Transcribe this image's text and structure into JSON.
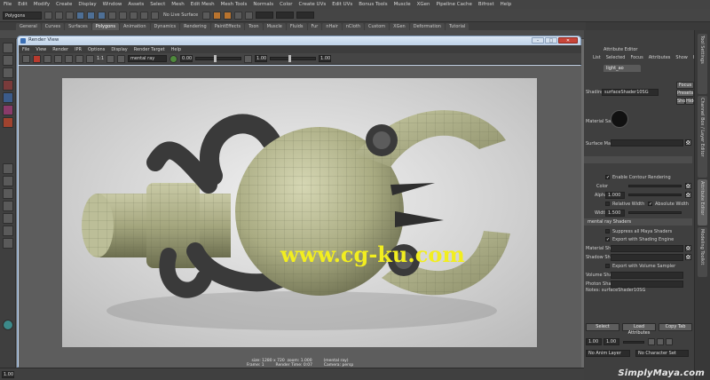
{
  "main_menu": [
    "File",
    "Edit",
    "Modify",
    "Create",
    "Display",
    "Window",
    "Assets",
    "Select",
    "Mesh",
    "Edit Mesh",
    "Mesh Tools",
    "Normals",
    "Color",
    "Create UVs",
    "Edit UVs",
    "Bonus Tools",
    "Muscle",
    "XGen",
    "Pipeline Cache",
    "Bifrost",
    "Help"
  ],
  "status_line": {
    "mode": "Polygons",
    "live_surface": "No Live Surface"
  },
  "shelf_tabs": [
    "General",
    "Curves",
    "Surfaces",
    "Polygons",
    "Animation",
    "Dynamics",
    "Rendering",
    "PaintEffects",
    "Toon",
    "Muscle",
    "Fluids",
    "Fur",
    "nHair",
    "nCloth",
    "Custom",
    "XGen",
    "Deformation",
    "Tutorial"
  ],
  "shelf_active": "Polygons",
  "render_view": {
    "title": "Render View",
    "menu": [
      "File",
      "View",
      "Render",
      "IPR",
      "Options",
      "Display",
      "Render Target",
      "Help"
    ],
    "renderer": "mental ray",
    "ratio_label": "1:1",
    "exposure": "0.00",
    "gamma": "1.00",
    "gamma2": "1.00",
    "info_line1": "size: 1280 x 720  zoom: 1.000         (mental ray)",
    "info_line2": "Frame: 1         Render Time: 0:07         Camera: persp",
    "window_buttons": {
      "minimize": "–",
      "maximize": "□",
      "close": "✕"
    }
  },
  "watermark_text": "www.cg-ku.com",
  "attribute_editor": {
    "title": "Attribute Editor",
    "menu": [
      "List",
      "Selected",
      "Focus",
      "Attributes",
      "Show",
      "Help"
    ],
    "node_tab": "light_ao",
    "shading_engine_label": "ShadingEngine:",
    "shading_engine_value": "surfaceShader10SG",
    "focus_btn": "Focus",
    "presets_btn": "Presets",
    "show_btn": "Show",
    "hide_btn": "Hide",
    "swatch_label": "Material Sample",
    "material_label": "Surface Material",
    "contour_label": "Enable Contour Rendering",
    "color_label": "Color",
    "alpha_label": "Alpha",
    "alpha_value": "1.000",
    "relative_width_label": "Relative Width",
    "absolute_width_label": "Absolute Width",
    "width_label": "Width",
    "width_value": "1.500",
    "shaders_section": "mental ray Shaders",
    "suppress_label": "Suppress all Maya Shaders",
    "export_engine_label": "Export with Shading Engine",
    "material_shader_label": "Material Shader",
    "shadow_shader_label": "Shadow Shader",
    "export_volume_label": "Export with Volume Sampler",
    "volume_shader_label": "Volume Shader",
    "photon_shader_label": "Photon Shader",
    "notes_label": "Notes: surfaceShader10SG",
    "bottom_buttons": [
      "Select",
      "Load Attributes",
      "Copy Tab"
    ]
  },
  "right_tabs": [
    "Tool Settings",
    "Channel Box / Layer Editor",
    "Attribute Editor",
    "Modeling Toolkit"
  ],
  "range_bar": {
    "start": "1.00",
    "end": "1.00",
    "anim_layer": "No Anim Layer",
    "character_set": "No Character Set"
  },
  "time_field": "1.00",
  "brand_watermark": "SimplyMaya.com"
}
